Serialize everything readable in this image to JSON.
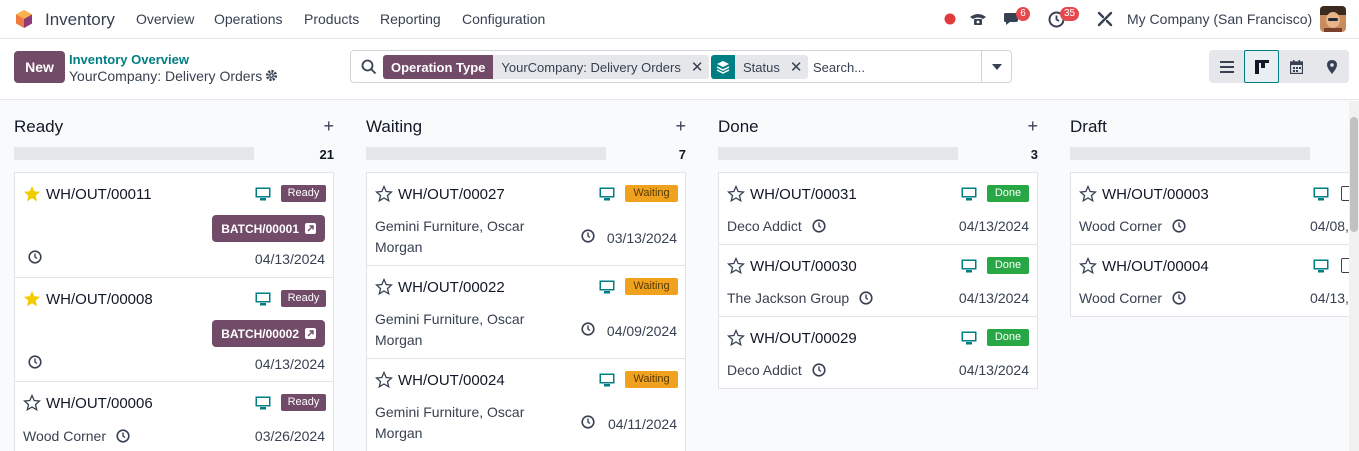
{
  "app": {
    "name": "Inventory"
  },
  "menu": [
    "Overview",
    "Operations",
    "Products",
    "Reporting",
    "Configuration"
  ],
  "systray": {
    "chat_count": "6",
    "activity_count": "35",
    "company": "My Company (San Francisco)"
  },
  "control": {
    "new_label": "New",
    "breadcrumb_parent": "Inventory Overview",
    "breadcrumb_current": "YourCompany: Delivery Orders",
    "facets": [
      {
        "label": "Operation Type",
        "value": "YourCompany: Delivery Orders"
      },
      {
        "label": "",
        "value": "Status"
      }
    ],
    "search_placeholder": "Search..."
  },
  "columns": [
    {
      "title": "Ready",
      "count": "21",
      "cards": [
        {
          "name": "WH/OUT/00011",
          "starred": true,
          "status": "Ready",
          "batch": "BATCH/00001",
          "partner": "",
          "date": "04/13/2024"
        },
        {
          "name": "WH/OUT/00008",
          "starred": true,
          "status": "Ready",
          "batch": "BATCH/00002",
          "partner": "",
          "date": "04/13/2024"
        },
        {
          "name": "WH/OUT/00006",
          "starred": false,
          "status": "Ready",
          "batch": "",
          "partner": "Wood Corner",
          "date": "03/26/2024"
        }
      ]
    },
    {
      "title": "Waiting",
      "count": "7",
      "cards": [
        {
          "name": "WH/OUT/00027",
          "starred": false,
          "status": "Waiting",
          "partner_line1": "Gemini Furniture, Oscar",
          "partner_line2": "Morgan",
          "date": "03/13/2024"
        },
        {
          "name": "WH/OUT/00022",
          "starred": false,
          "status": "Waiting",
          "partner_line1": "Gemini Furniture, Oscar",
          "partner_line2": "Morgan",
          "date": "04/09/2024"
        },
        {
          "name": "WH/OUT/00024",
          "starred": false,
          "status": "Waiting",
          "partner_line1": "Gemini Furniture, Oscar",
          "partner_line2": "Morgan",
          "date": "04/11/2024"
        }
      ]
    },
    {
      "title": "Done",
      "count": "3",
      "cards": [
        {
          "name": "WH/OUT/00031",
          "starred": false,
          "status": "Done",
          "partner": "Deco Addict",
          "date": "04/13/2024"
        },
        {
          "name": "WH/OUT/00030",
          "starred": false,
          "status": "Done",
          "partner": "The Jackson Group",
          "date": "04/13/2024"
        },
        {
          "name": "WH/OUT/00029",
          "starred": false,
          "status": "Done",
          "partner": "Deco Addict",
          "date": "04/13/2024"
        }
      ]
    },
    {
      "title": "Draft",
      "count": "",
      "cards": [
        {
          "name": "WH/OUT/00003",
          "starred": false,
          "status": "",
          "partner": "Wood Corner",
          "date": "04/08,"
        },
        {
          "name": "WH/OUT/00004",
          "starred": false,
          "status": "",
          "partner": "Wood Corner",
          "date": "04/13,"
        }
      ]
    }
  ],
  "colors": {
    "brand": "#714b67",
    "accent": "#017e84",
    "ready": "#714b67",
    "waiting": "#f0a21f",
    "done": "#28a745",
    "star": "#f3cc00"
  }
}
